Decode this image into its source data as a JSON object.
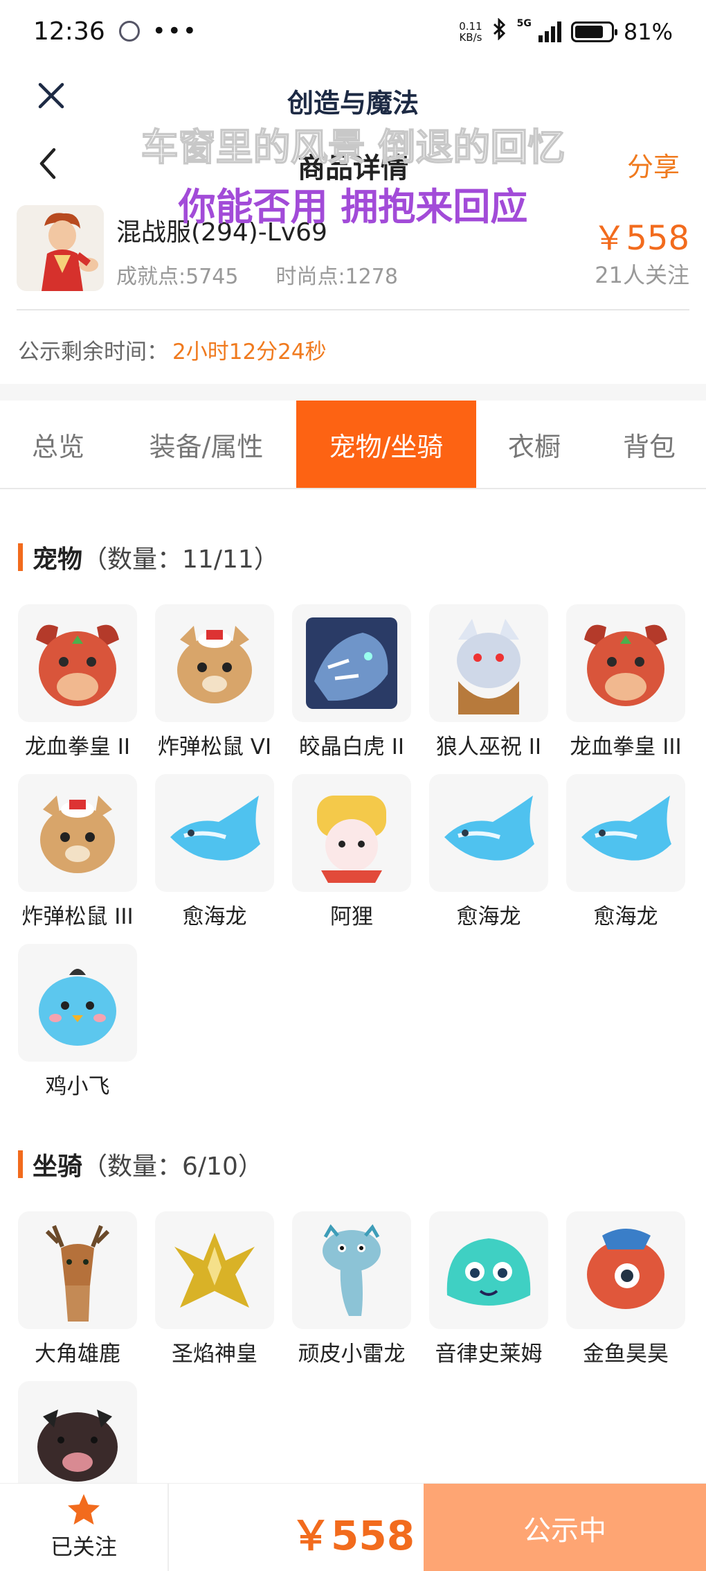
{
  "status_bar": {
    "time": "12:36",
    "dots": "•••",
    "net_speed_value": "0.11",
    "net_speed_unit": "KB/s",
    "network": "5G",
    "battery": "81%"
  },
  "top_nav": {
    "title": "创造与魔法"
  },
  "overlay": {
    "lyric_line1": "车窗里的风景 倒退的回忆",
    "lyric_line2": "你能否用 拥抱来回应"
  },
  "header": {
    "title": "商品详情",
    "share": "分享"
  },
  "product": {
    "name": "混战服(294)-Lv69",
    "achievement": "成就点:5745",
    "fashion": "时尚点:1278",
    "price": "￥558",
    "followers": "21人关注"
  },
  "countdown": {
    "label": "公示剩余时间：",
    "value": "2小时12分24秒"
  },
  "tabs": [
    {
      "label": "总览",
      "active": false
    },
    {
      "label": "装备/属性",
      "active": false
    },
    {
      "label": "宠物/坐骑",
      "active": true
    },
    {
      "label": "衣橱",
      "active": false
    },
    {
      "label": "背包",
      "active": false
    }
  ],
  "pets": {
    "title": "宠物",
    "count": "（数量：11/11）",
    "items": [
      {
        "name": "龙血拳皇 II",
        "icon": "dragon-boxer-icon",
        "color": "#d9553b"
      },
      {
        "name": "炸弹松鼠 VI",
        "icon": "bomb-squirrel-icon",
        "color": "#d8a56a"
      },
      {
        "name": "皎晶白虎 II",
        "icon": "white-tiger-icon",
        "color": "#6f95c9"
      },
      {
        "name": "狼人巫祝 II",
        "icon": "werewolf-shaman-icon",
        "color": "#b77a3c"
      },
      {
        "name": "龙血拳皇 III",
        "icon": "dragon-boxer-icon",
        "color": "#d9553b"
      },
      {
        "name": "炸弹松鼠 III",
        "icon": "bomb-squirrel-icon",
        "color": "#d8a56a"
      },
      {
        "name": "愈海龙",
        "icon": "sea-dragon-icon",
        "color": "#4fc2ef"
      },
      {
        "name": "阿狸",
        "icon": "ali-icon",
        "color": "#f4c94a"
      },
      {
        "name": "愈海龙",
        "icon": "sea-dragon-icon",
        "color": "#4fc2ef"
      },
      {
        "name": "愈海龙",
        "icon": "sea-dragon-icon",
        "color": "#4fc2ef"
      },
      {
        "name": "鸡小飞",
        "icon": "chick-icon",
        "color": "#5cc7ee"
      }
    ]
  },
  "mounts": {
    "title": "坐骑",
    "count": "（数量：6/10）",
    "items": [
      {
        "name": "大角雄鹿",
        "icon": "stag-icon",
        "color": "#b5713b"
      },
      {
        "name": "圣焰神皇",
        "icon": "phoenix-icon",
        "color": "#d9b227"
      },
      {
        "name": "顽皮小雷龙",
        "icon": "thunder-dragon-icon",
        "color": "#8cc3d6"
      },
      {
        "name": "音律史莱姆",
        "icon": "slime-icon",
        "color": "#3fd0c3"
      },
      {
        "name": "金鱼昊昊",
        "icon": "goldfish-icon",
        "color": "#e0573b"
      },
      {
        "name": "",
        "icon": "pig-icon",
        "color": "#3a2a2a"
      }
    ]
  },
  "bottom_bar": {
    "follow_label": "已关注",
    "price": "￥558",
    "status": "公示中",
    "accent": "#f26b1d"
  }
}
